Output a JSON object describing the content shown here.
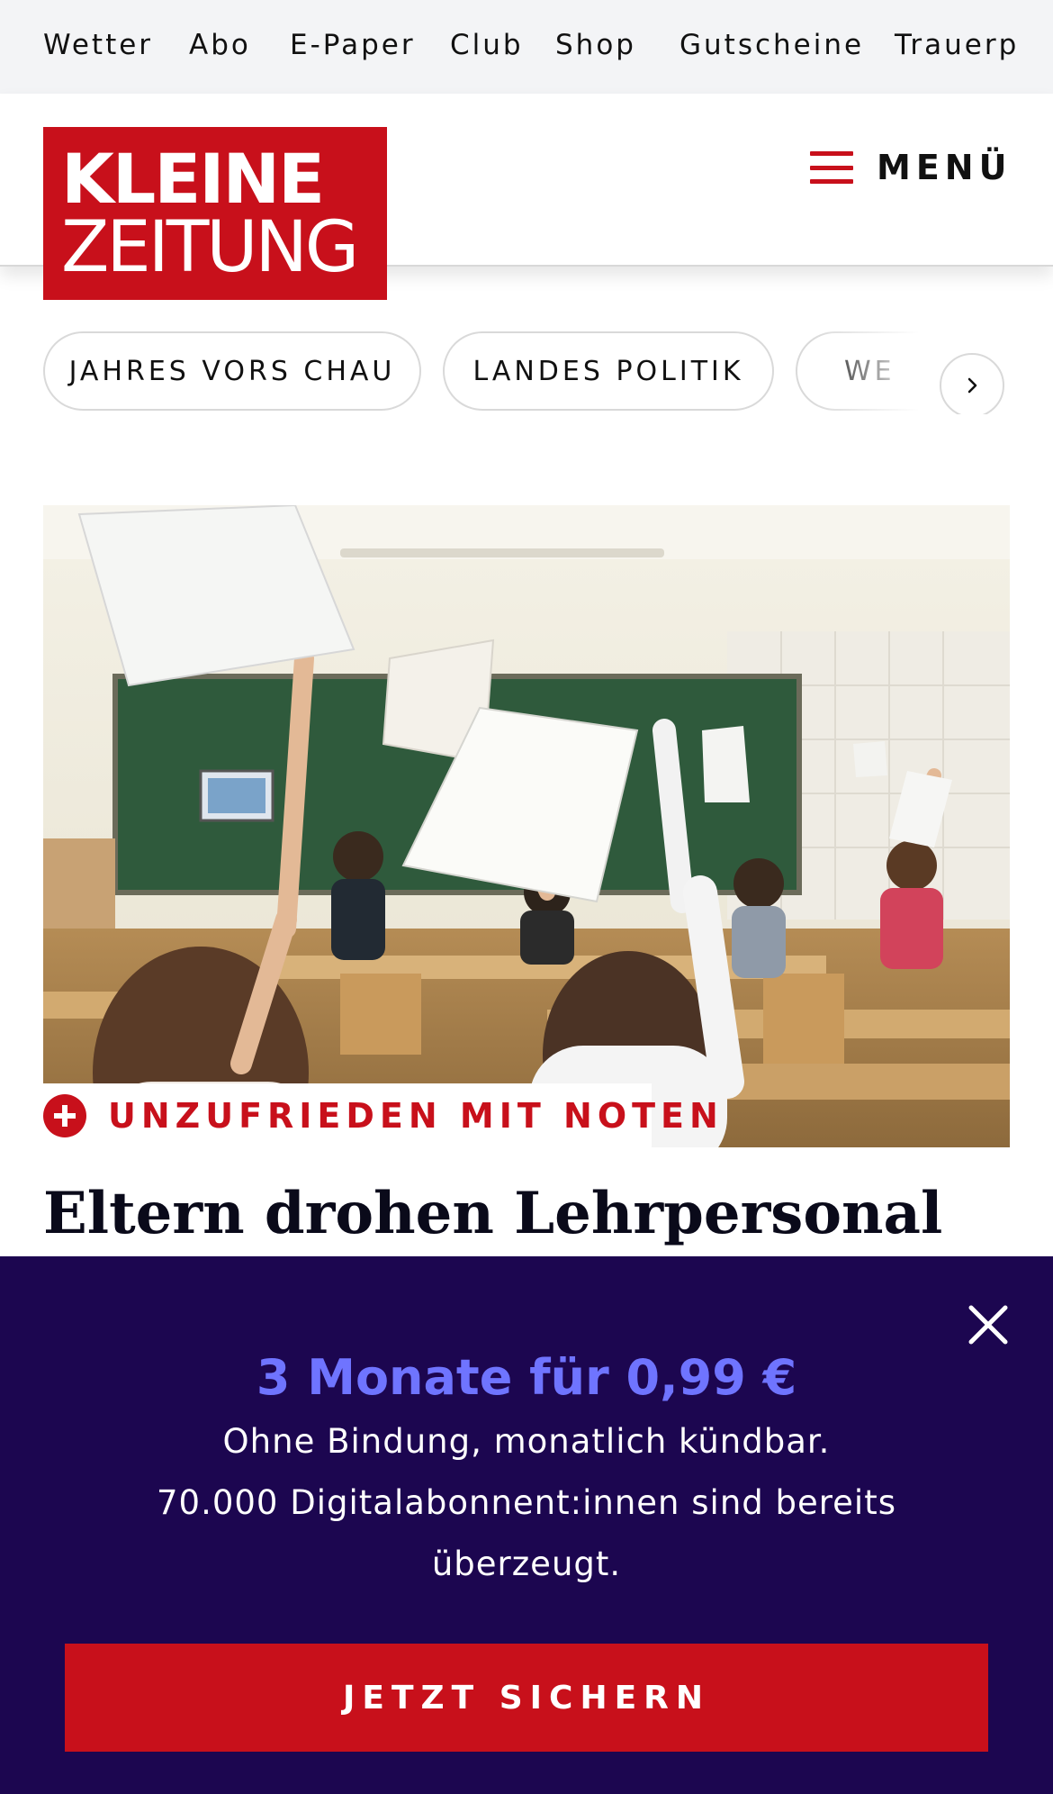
{
  "top_nav": {
    "items": [
      "Wetter",
      "Abo",
      "E-Paper",
      "Club",
      "Shop",
      "Gutscheine",
      "Trauerp"
    ]
  },
  "header": {
    "logo_line1": "KLEINE",
    "logo_line2": "ZEITUNG",
    "menu_label": "MENÜ"
  },
  "topics": {
    "chips": [
      "JAHRES VORS CHAU",
      "LANDES POLITIK",
      "WE"
    ]
  },
  "article": {
    "kicker": "UNZUFRIEDEN MIT NOTEN",
    "headline": "Eltern drohen Lehrpersonal"
  },
  "overlay": {
    "offer": "3 Monate für 0,99 €",
    "line1": "Ohne Bindung, monatlich kündbar.",
    "line2": "70.000 Digitalabonnent:innen sind bereits",
    "line3": "überzeugt.",
    "cta": "JETZT SICHERN"
  },
  "colors": {
    "brand_red": "#c8101b",
    "overlay_bg": "#1c0650",
    "offer_accent": "#6f74ff",
    "topbar_bg": "#f3f4f6"
  },
  "icons": {
    "menu": "hamburger-icon",
    "chip_next": "chevron-right-icon",
    "kicker": "plus-circle-icon",
    "close": "close-icon"
  }
}
